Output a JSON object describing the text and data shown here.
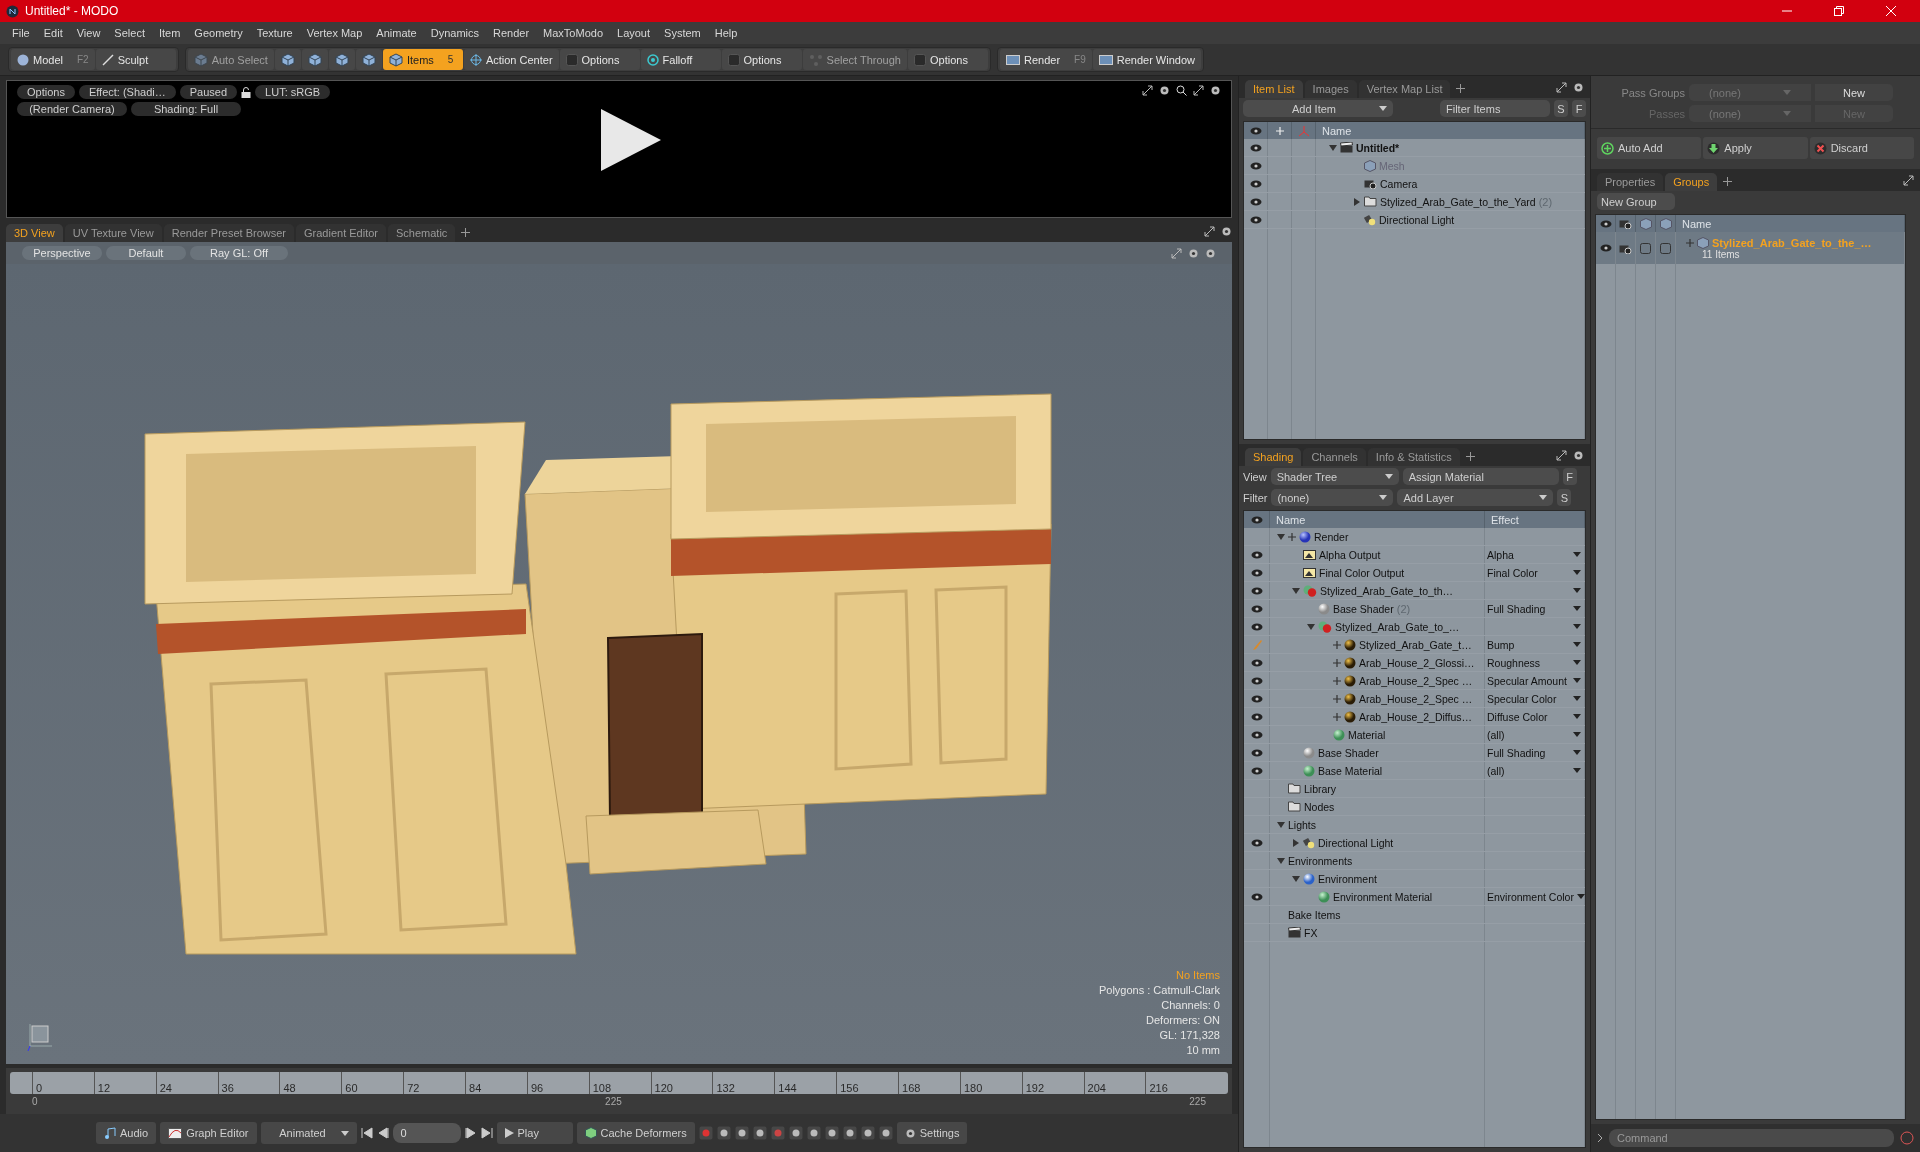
{
  "window": {
    "title": "Untitled* - MODO"
  },
  "menu": [
    "File",
    "Edit",
    "View",
    "Select",
    "Item",
    "Geometry",
    "Texture",
    "Vertex Map",
    "Animate",
    "Dynamics",
    "Render",
    "MaxToModo",
    "Layout",
    "System",
    "Help"
  ],
  "toolbar": [
    [
      {
        "kind": "button",
        "label": "Model",
        "shortcut": "F2",
        "selected": false,
        "disabled": false
      },
      {
        "kind": "button",
        "label": "Sculpt",
        "selected": false,
        "disabled": false
      }
    ],
    [
      {
        "kind": "button",
        "label": "Auto Select",
        "selected": false,
        "disabled": true
      },
      {
        "kind": "icon",
        "selected": false,
        "disabled": false
      },
      {
        "kind": "icon",
        "selected": false,
        "disabled": false
      },
      {
        "kind": "icon",
        "selected": false,
        "disabled": false
      },
      {
        "kind": "icon",
        "selected": false,
        "disabled": false
      },
      {
        "kind": "button",
        "label": "Items",
        "shortcut": "5",
        "selected": true,
        "disabled": false
      },
      {
        "kind": "button",
        "label": "Action Center",
        "selected": false,
        "disabled": false
      },
      {
        "kind": "button",
        "label": "Options",
        "selected": false,
        "disabled": false
      },
      {
        "kind": "button",
        "label": "Falloff",
        "selected": false,
        "disabled": false
      },
      {
        "kind": "button",
        "label": "Options",
        "selected": false,
        "disabled": false
      },
      {
        "kind": "button",
        "label": "Select Through",
        "selected": false,
        "disabled": true
      },
      {
        "kind": "button",
        "label": "Options",
        "selected": false,
        "disabled": false
      }
    ],
    [
      {
        "kind": "button",
        "label": "Render",
        "shortcut": "F9",
        "selected": false,
        "disabled": false
      },
      {
        "kind": "button",
        "label": "Render Window",
        "selected": false,
        "disabled": false
      }
    ]
  ],
  "preview": {
    "buttons": [
      [
        "Options",
        "Effect: (Shadi…",
        "Paused",
        "LUT: sRGB"
      ],
      [
        "(Render Camera)",
        "Shading: Full"
      ]
    ]
  },
  "view_tabs": [
    {
      "label": "3D View",
      "selected": true
    },
    {
      "label": "UV Texture View",
      "selected": false
    },
    {
      "label": "Render Preset Browser",
      "selected": false
    },
    {
      "label": "Gradient Editor",
      "selected": false
    },
    {
      "label": "Schematic",
      "selected": false
    }
  ],
  "viewport": {
    "buttons": [
      "Perspective",
      "Default",
      "Ray GL: Off"
    ],
    "stats": [
      {
        "text": "No Items",
        "kind": "warning"
      },
      {
        "text": "Polygons : Catmull-Clark",
        "kind": "info"
      },
      {
        "text": "Channels: 0",
        "kind": "info"
      },
      {
        "text": "Deformers: ON",
        "kind": "info"
      },
      {
        "text": "GL: 171,328",
        "kind": "info"
      },
      {
        "text": "10 mm",
        "kind": "info"
      }
    ]
  },
  "timeline": {
    "ticks": [
      "0",
      "12",
      "24",
      "36",
      "48",
      "60",
      "72",
      "84",
      "96",
      "108",
      "120",
      "132",
      "144",
      "156",
      "168",
      "180",
      "192",
      "204",
      "216"
    ],
    "start": "0",
    "middle": "225",
    "end": "225"
  },
  "bottom_bar": {
    "audio": "Audio",
    "graph_editor": "Graph Editor",
    "mode": "Animated",
    "frame": "0",
    "play": "Play",
    "cache": "Cache Deformers",
    "settings": "Settings"
  },
  "item_list": {
    "tabs": [
      {
        "label": "Item List",
        "selected": true
      },
      {
        "label": "Images",
        "selected": false
      },
      {
        "label": "Vertex Map List",
        "selected": false
      }
    ],
    "add_item": "Add Item",
    "filter_placeholder": "Filter Items",
    "s": "S",
    "f": "F",
    "column": "Name",
    "tree": [
      {
        "name": "Untitled*",
        "kind": "scene",
        "expanded": true,
        "dimmed": false,
        "children": [
          {
            "name": "Mesh",
            "kind": "mesh",
            "dimmed": true
          },
          {
            "name": "Camera",
            "kind": "camera",
            "dimmed": false
          },
          {
            "name": "Stylized_Arab_Gate_to_the_Yard",
            "count": "(2)",
            "kind": "folder",
            "expanded": false,
            "dimmed": false
          },
          {
            "name": "Directional Light",
            "kind": "light",
            "dimmed": false
          }
        ]
      }
    ]
  },
  "shading": {
    "tabs": [
      {
        "label": "Shading",
        "selected": true
      },
      {
        "label": "Channels",
        "selected": false
      },
      {
        "label": "Info & Statistics",
        "selected": false
      }
    ],
    "view_label": "View",
    "view": "Shader Tree",
    "assign": "Assign Material",
    "f": "F",
    "filter_label": "Filter",
    "filter": "(none)",
    "add_layer": "Add Layer",
    "s": "S",
    "columns": [
      "Name",
      "Effect"
    ],
    "tree": [
      {
        "name": "Render",
        "kind": "render",
        "visible": false,
        "expanded": true,
        "children": [
          {
            "name": "Alpha Output",
            "kind": "output",
            "visible": true,
            "effect": "Alpha"
          },
          {
            "name": "Final Color Output",
            "kind": "output",
            "visible": true,
            "effect": "Final Color"
          },
          {
            "name": "Stylized_Arab_Gate_to_th…",
            "kind": "group",
            "visible": true,
            "expanded": true,
            "children": [
              {
                "name": "Base Shader",
                "count": "(2)",
                "kind": "shader",
                "visible": true,
                "effect": "Full Shading"
              },
              {
                "name": "Stylized_Arab_Gate_to_…",
                "kind": "group",
                "visible": true,
                "expanded": true,
                "children": [
                  {
                    "name": "Stylized_Arab_Gate_t…",
                    "kind": "layer",
                    "visible": true,
                    "editing": true,
                    "effect": "Bump"
                  },
                  {
                    "name": "Arab_House_2_Glossi…",
                    "kind": "layer",
                    "visible": true,
                    "editing": false,
                    "effect": "Roughness"
                  },
                  {
                    "name": "Arab_House_2_Spec …",
                    "kind": "layer",
                    "visible": true,
                    "editing": false,
                    "effect": "Specular Amount"
                  },
                  {
                    "name": "Arab_House_2_Spec …",
                    "kind": "layer",
                    "visible": true,
                    "editing": false,
                    "effect": "Specular Color"
                  },
                  {
                    "name": "Arab_House_2_Diffus…",
                    "kind": "layer",
                    "visible": true,
                    "editing": false,
                    "effect": "Diffuse Color"
                  },
                  {
                    "name": "Material",
                    "kind": "material",
                    "visible": true,
                    "editing": false,
                    "effect": "(all)"
                  }
                ]
              }
            ]
          },
          {
            "name": "Base Shader",
            "kind": "shader",
            "visible": true,
            "effect": "Full Shading"
          },
          {
            "name": "Base Material",
            "kind": "material",
            "visible": true,
            "effect": "(all)"
          }
        ]
      },
      {
        "name": "Library",
        "kind": "folder",
        "visible": false
      },
      {
        "name": "Nodes",
        "kind": "folder",
        "visible": false
      },
      {
        "name": "Lights",
        "kind": "category",
        "visible": false,
        "expanded": true,
        "children": [
          {
            "name": "Directional Light",
            "kind": "light",
            "visible": true,
            "expanded": false
          }
        ]
      },
      {
        "name": "Environments",
        "kind": "category",
        "visible": false,
        "expanded": true,
        "children": [
          {
            "name": "Environment",
            "kind": "environment",
            "visible": false,
            "expanded": true,
            "children": [
              {
                "name": "Environment Material",
                "kind": "material",
                "visible": true,
                "effect": "Environment Color"
              }
            ]
          }
        ]
      },
      {
        "name": "Bake Items",
        "kind": "category",
        "visible": false
      },
      {
        "name": "FX",
        "kind": "fx",
        "visible": false
      }
    ]
  },
  "passes": {
    "rows": [
      {
        "label": "Pass Groups",
        "value": "(none)",
        "button": "New",
        "disabled": false
      },
      {
        "label": "Passes",
        "value": "(none)",
        "button": "New",
        "disabled": true
      }
    ],
    "actions": [
      "Auto Add",
      "Apply",
      "Discard"
    ]
  },
  "groups": {
    "tabs": [
      {
        "label": "Properties",
        "selected": false
      },
      {
        "label": "Groups",
        "selected": true
      }
    ],
    "new_group": "New Group",
    "column": "Name",
    "items": [
      {
        "name": "Stylized_Arab_Gate_to_the_…",
        "sub": "11 Items",
        "selected": true
      }
    ]
  },
  "command": {
    "placeholder": "Command"
  }
}
